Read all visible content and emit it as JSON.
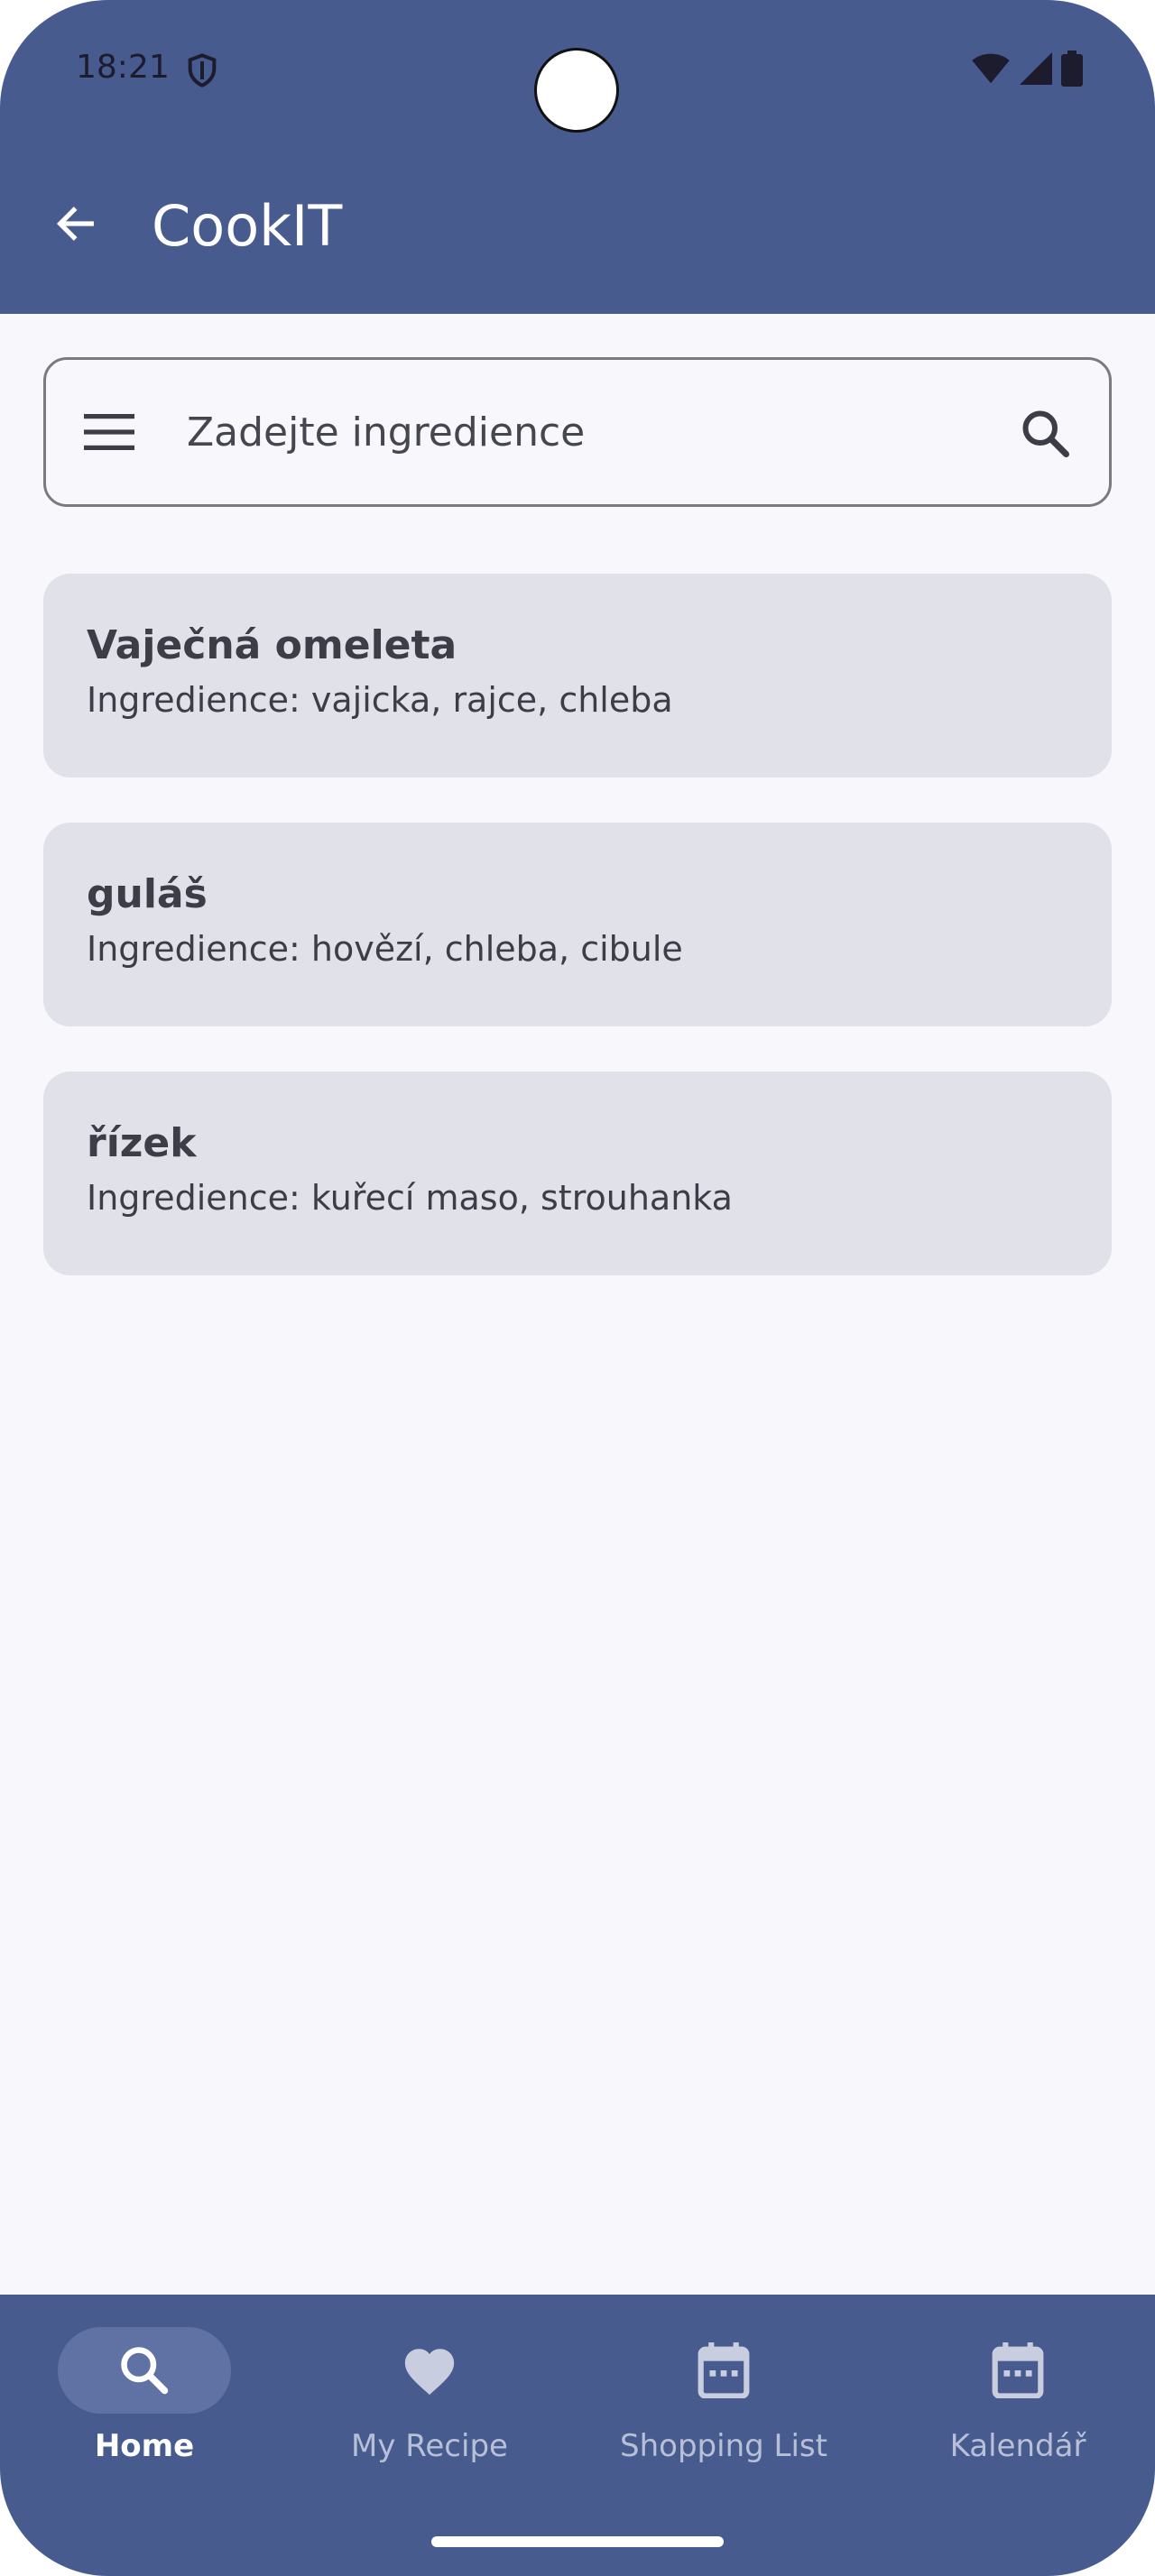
{
  "status_bar": {
    "time": "18:21"
  },
  "app_bar": {
    "title": "CookIT"
  },
  "search": {
    "placeholder": "Zadejte ingredience"
  },
  "recipes": [
    {
      "name": "Vaječná omeleta",
      "ingredients": "Ingredience: vajicka, rajce, chleba"
    },
    {
      "name": "guláš",
      "ingredients": "Ingredience: hovězí, chleba, cibule"
    },
    {
      "name": "řízek",
      "ingredients": "Ingredience: kuřecí maso, strouhanka"
    }
  ],
  "bottom_nav": {
    "items": [
      {
        "label": "Home",
        "icon": "search-icon",
        "active": true
      },
      {
        "label": "My Recipe",
        "icon": "heart-icon",
        "active": false
      },
      {
        "label": "Shopping List",
        "icon": "calendar-icon",
        "active": false
      },
      {
        "label": "Kalendář",
        "icon": "calendar-icon",
        "active": false
      }
    ]
  },
  "colors": {
    "primary": "#475b8f",
    "background": "#f7f7fc",
    "card": "#e1e1ea",
    "nav_active_pill": "#5f72a3"
  }
}
